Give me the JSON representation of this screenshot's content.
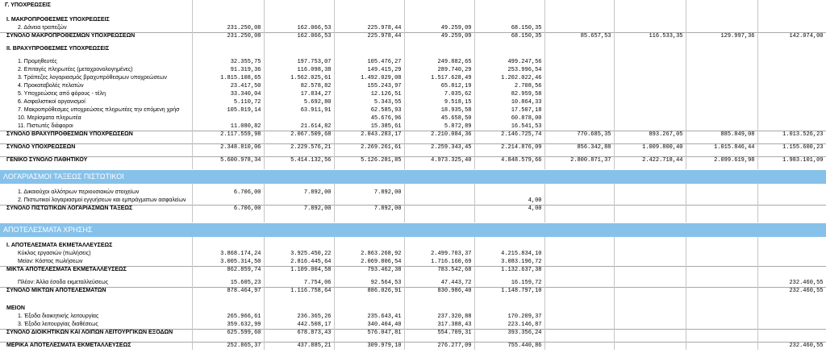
{
  "colors": {
    "band_background": "#86c1ea",
    "band_text": "#ffffff",
    "grid": "#c6c6c6"
  },
  "rows": [
    {
      "kind": "title",
      "label": "Γ. ΥΠΟΧΡΕΩΣΕΙΣ"
    },
    {
      "kind": "blank"
    },
    {
      "kind": "section",
      "label": "I. ΜΑΚΡΟΠΡΟΘΕΣΜΕΣ ΥΠΟΧΡΕΩΣΕΙΣ"
    },
    {
      "kind": "item",
      "label": "2. Δάνεια τραπεζών",
      "values": [
        "231.250,08",
        "162.066,53",
        "225.978,44",
        "49.259,09",
        "68.150,35",
        "",
        "",
        "",
        ""
      ]
    },
    {
      "kind": "total",
      "label": "ΣΥΝΟΛΟ ΜΑΚΡΟΠΡΟΘΕΣΜΩΝ ΥΠΟΧΡΕΩΣΕΩΝ",
      "values": [
        "231.250,08",
        "162.066,53",
        "225.978,44",
        "49.259,09",
        "68.150,35",
        "85.657,53",
        "116.533,35",
        "129.997,36",
        "142.074,00"
      ]
    },
    {
      "kind": "blank"
    },
    {
      "kind": "section",
      "label": "II. ΒΡΑΧΥΠΡΟΘΕΣΜΕΣ ΥΠΟΧΡΕΩΣΕΙΣ"
    },
    {
      "kind": "blank"
    },
    {
      "kind": "item",
      "label": "1. Προμηθευτές",
      "values": [
        "32.355,75",
        "197.753,07",
        "105.476,27",
        "249.882,65",
        "499.247,56",
        "",
        "",
        "",
        ""
      ]
    },
    {
      "kind": "item",
      "label": "2. Επιταγές πληρωτέες (μεταχρονολογημένες)",
      "values": [
        "91.319,36",
        "116.098,38",
        "149.415,29",
        "289.740,29",
        "253.996,54",
        "",
        "",
        "",
        ""
      ]
    },
    {
      "kind": "item",
      "label": "3. Τράπεζες λογαριασμός βραχυπρόθεσμων υποχρεώσεων",
      "values": [
        "1.815.108,65",
        "1.562.025,61",
        "1.492.029,08",
        "1.517.628,49",
        "1.202.022,46",
        "",
        "",
        "",
        ""
      ]
    },
    {
      "kind": "item",
      "label": "4. Προκαταβολές πελατών",
      "values": [
        "23.417,50",
        "82.578,82",
        "155.243,97",
        "65.812,19",
        "2.708,56",
        "",
        "",
        "",
        ""
      ]
    },
    {
      "kind": "item",
      "label": "5. Υποχρεώσεις από φόρους - τέλη",
      "values": [
        "33.340,04",
        "17.834,27",
        "12.126,51",
        "7.035,62",
        "82.959,58",
        "",
        "",
        "",
        ""
      ]
    },
    {
      "kind": "item",
      "label": "6. Ασφαλιστικοί οργανισμοί",
      "values": [
        "5.110,72",
        "5.692,80",
        "5.343,55",
        "9.518,15",
        "10.864,33",
        "",
        "",
        "",
        ""
      ]
    },
    {
      "kind": "item",
      "label": "7. Μακροπρόθεσμες υποχρεώσεις πληρωτέες την επόμενη χρήσ",
      "values": [
        "105.819,14",
        "63.911,91",
        "62.585,93",
        "18.935,58",
        "17.507,18",
        "",
        "",
        "",
        ""
      ]
    },
    {
      "kind": "item",
      "label": "10. Μερίσματα πληρωτέα",
      "values": [
        "",
        "",
        "45.676,96",
        "45.658,50",
        "60.878,00",
        "",
        "",
        "",
        ""
      ]
    },
    {
      "kind": "item",
      "label": "11. Πιστωτές διάφοροι",
      "values": [
        "11.080,82",
        "21.614,82",
        "15.385,61",
        "5.872,89",
        "16.541,53",
        "",
        "",
        "",
        ""
      ]
    },
    {
      "kind": "total",
      "label": "ΣΥΝΟΛΟ ΒΡΑΧΥΠΡΟΘΕΣΜΩΝ ΥΠΟΧΡΕΩΣΕΩΝ",
      "values": [
        "2.117.559,98",
        "2.067.509,68",
        "2.043.283,17",
        "2.210.084,36",
        "2.146.725,74",
        "770.685,35",
        "893.267,05",
        "885.849,08",
        "1.013.526,23"
      ]
    },
    {
      "kind": "blank"
    },
    {
      "kind": "total",
      "label": "ΣΥΝΟΛΟ ΥΠΟΧΡΕΩΣΕΩΝ",
      "values": [
        "2.348.810,06",
        "2.229.576,21",
        "2.269.261,61",
        "2.259.343,45",
        "2.214.876,09",
        "856.342,88",
        "1.009.800,40",
        "1.015.846,44",
        "1.155.600,23"
      ]
    },
    {
      "kind": "blank"
    },
    {
      "kind": "total",
      "label": "ΓΕΝΙΚΟ ΣΥΝΟΛΟ ΠΑΘΗΤΙΚΟΥ",
      "values": [
        "5.600.978,34",
        "5.414.132,56",
        "5.126.281,85",
        "4.973.325,40",
        "4.848.579,66",
        "2.800.871,37",
        "2.422.718,44",
        "2.099.619,98",
        "1.983.101,09"
      ]
    },
    {
      "kind": "blank"
    },
    {
      "kind": "band",
      "label": "ΛΟΓΑΡΙΑΣΜΟΙ ΤΑΞΕΩΣ ΠΙΣΤΩΤΙΚΟΙ"
    },
    {
      "kind": "blank"
    },
    {
      "kind": "item",
      "label": "1. Δικαιούχοι αλλότριων περιουσιακών στοιχείων",
      "values": [
        "6.706,00",
        "7.892,00",
        "7.892,00",
        "",
        "",
        "",
        "",
        "",
        ""
      ]
    },
    {
      "kind": "item",
      "label": "2. Πιστωτικοί λογαριασμοί εγγυήσεων και εμπράγματων ασφαλείων",
      "values": [
        "",
        "",
        "",
        "",
        "4,00",
        "",
        "",
        "",
        ""
      ]
    },
    {
      "kind": "total",
      "label": "ΣΥΝΟΛΟ ΠΙΣΤΩΤΙΚΩΝ ΛΟΓΑΡΙΑΣΜΩΝ ΤΑΞΕΩΣ",
      "values": [
        "6.706,00",
        "7.892,00",
        "7.892,00",
        "",
        "4,00",
        "",
        "",
        "",
        ""
      ]
    },
    {
      "kind": "blank"
    },
    {
      "kind": "blank"
    },
    {
      "kind": "band",
      "label": "ΑΠΟΤΕΛΕΣΜΑΤΑ ΧΡΗΣΗΣ"
    },
    {
      "kind": "blank"
    },
    {
      "kind": "section",
      "label": "I. ΑΠΟΤΕΛΕΣΜΑΤΑ ΕΚΜΕΤΑΛΛΕΥΣΕΩΣ"
    },
    {
      "kind": "item",
      "label": "Κύκλος εργασιών (πωλήσεις)",
      "values": [
        "3.868.174,24",
        "3.925.450,22",
        "2.863.268,92",
        "2.499.703,37",
        "4.215.834,10",
        "",
        "",
        "",
        ""
      ]
    },
    {
      "kind": "item",
      "label": "Μείον: Κόστος πωλήσεων",
      "values": [
        "3.005.314,50",
        "2.816.445,64",
        "2.069.806,54",
        "1.716.160,69",
        "3.083.196,72",
        "",
        "",
        "",
        ""
      ]
    },
    {
      "kind": "total",
      "label": "ΜΙΚΤΑ ΑΠΟΤΕΛΕΣΜΑΤΑ ΕΚΜΕΤΑΛΛΕΥΣΕΩΣ",
      "values": [
        "862.859,74",
        "1.109.004,58",
        "793.462,38",
        "783.542,68",
        "1.132.637,38",
        "",
        "",
        "",
        ""
      ]
    },
    {
      "kind": "blank"
    },
    {
      "kind": "item",
      "label": "Πλέον: Άλλα έσοδα εκμεταλλεύσεως",
      "values": [
        "15.605,23",
        "7.754,06",
        "92.564,53",
        "47.443,72",
        "16.159,72",
        "",
        "",
        "",
        "232.460,55"
      ]
    },
    {
      "kind": "total",
      "label": "ΣΥΝΟΛΟ ΜΙΚΤΩΝ ΑΠΟΤΕΛΕΣΜΑΤΩΝ",
      "values": [
        "878.464,97",
        "1.116.758,64",
        "886.026,91",
        "830.986,40",
        "1.148.797,10",
        "",
        "",
        "",
        "232.460,55"
      ]
    },
    {
      "kind": "blank"
    },
    {
      "kind": "blank"
    },
    {
      "kind": "section",
      "label": "ΜΕΙΟΝ"
    },
    {
      "kind": "item",
      "label": "1. Έξοδα διοικητικής λειτουργίας",
      "values": [
        "265.966,61",
        "236.365,26",
        "235.643,41",
        "237.320,88",
        "170.209,37",
        "",
        "",
        "",
        ""
      ]
    },
    {
      "kind": "item",
      "label": "3. Έξοδα λειτουργίας διαθέσεως",
      "values": [
        "359.632,99",
        "442.508,17",
        "340.404,40",
        "317.388,43",
        "223.146,87",
        "",
        "",
        "",
        ""
      ]
    },
    {
      "kind": "total",
      "label": "ΣΥΝΟΛΟ ΔΙΟΙΚΗΤΙΚΩΝ ΚΑΙ ΛΟΙΠΩΝ ΛΕΙΤΟΥΡΓΙΚΩΝ ΕΞΟΔΩΝ",
      "values": [
        "625.599,60",
        "678.873,43",
        "576.047,81",
        "554.709,31",
        "393.356,24",
        "",
        "",
        "",
        ""
      ]
    },
    {
      "kind": "blank"
    },
    {
      "kind": "total",
      "label": "ΜΕΡΙΚΑ ΑΠΟΤΕΛΕΣΜΑΤΑ ΕΚΜΕΤΑΛΛΕΥΣΕΩΣ",
      "values": [
        "252.865,37",
        "437.885,21",
        "309.979,10",
        "276.277,09",
        "755.440,86",
        "",
        "",
        "",
        "232.460,55"
      ]
    }
  ]
}
